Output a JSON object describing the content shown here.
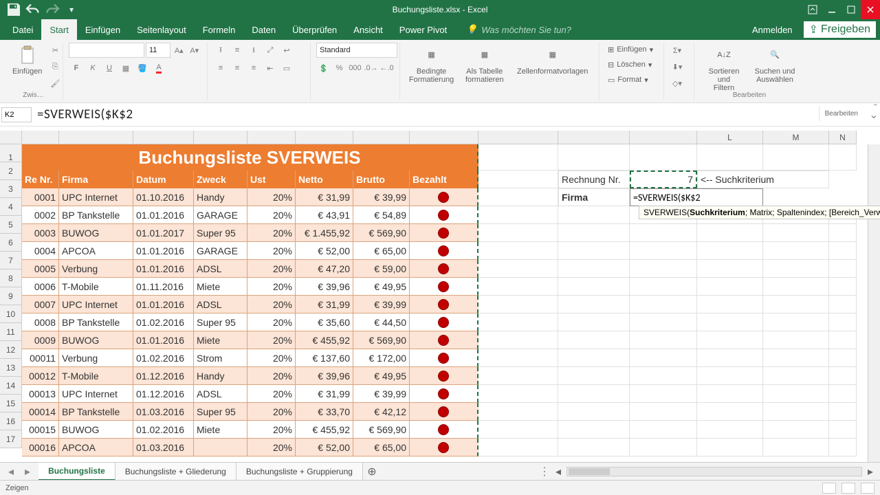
{
  "titlebar": {
    "doc_title": "Buchungsliste.xlsx - Excel"
  },
  "tabs": {
    "file": "Datei",
    "start": "Start",
    "insert": "Einfügen",
    "pagelayout": "Seitenlayout",
    "formulas": "Formeln",
    "data": "Daten",
    "review": "Überprüfen",
    "view": "Ansicht",
    "powerpivot": "Power Pivot",
    "tellme_placeholder": "Was möchten Sie tun?",
    "signin": "Anmelden",
    "share": "Freigeben"
  },
  "ribbon": {
    "paste": "Einfügen",
    "clip": "Zwis…",
    "font_name": "",
    "font_size": "11",
    "number_format": "Standard",
    "cond": "Bedingte\nFormatierung",
    "table": "Als Tabelle\nformatieren",
    "styles": "Zellenformatvorlagen",
    "insert_btn": "Einfügen",
    "delete_btn": "Löschen",
    "format_btn": "Format",
    "sort": "Sortieren und\nFiltern",
    "find": "Suchen und\nAuswählen",
    "edit_group": "Bearbeiten"
  },
  "formula_bar": {
    "name_box": "K2",
    "formula": "=SVERWEIS($K$2"
  },
  "col_letters": [
    "L",
    "M",
    "N"
  ],
  "table": {
    "title": "Buchungsliste SVERWEIS",
    "headers": [
      "Re Nr.",
      "Firma",
      "Datum",
      "Zweck",
      "Ust",
      "Netto",
      "Brutto",
      "Bezahlt"
    ],
    "rows": [
      [
        "0001",
        "UPC Internet",
        "01.10.2016",
        "Handy",
        "20%",
        "€     31,99",
        "€ 39,99"
      ],
      [
        "0002",
        "BP Tankstelle",
        "01.01.2016",
        "GARAGE",
        "20%",
        "€     43,91",
        "€ 54,89"
      ],
      [
        "0003",
        "BUWOG",
        "01.01.2017",
        "Super 95",
        "20%",
        "€ 1.455,92",
        "€ 569,90"
      ],
      [
        "0004",
        "APCOA",
        "01.01.2016",
        "GARAGE",
        "20%",
        "€     52,00",
        "€ 65,00"
      ],
      [
        "0005",
        "Verbung",
        "01.01.2016",
        "ADSL",
        "20%",
        "€     47,20",
        "€ 59,00"
      ],
      [
        "0006",
        "T-Mobile",
        "01.11.2016",
        "Miete",
        "20%",
        "€     39,96",
        "€ 49,95"
      ],
      [
        "0007",
        "UPC Internet",
        "01.01.2016",
        "ADSL",
        "20%",
        "€     31,99",
        "€ 39,99"
      ],
      [
        "0008",
        "BP Tankstelle",
        "01.02.2016",
        "Super 95",
        "20%",
        "€     35,60",
        "€ 44,50"
      ],
      [
        "0009",
        "BUWOG",
        "01.01.2016",
        "Miete",
        "20%",
        "€   455,92",
        "€ 569,90"
      ],
      [
        "00011",
        "Verbung",
        "01.02.2016",
        "Strom",
        "20%",
        "€   137,60",
        "€ 172,00"
      ],
      [
        "00012",
        "T-Mobile",
        "01.12.2016",
        "Handy",
        "20%",
        "€     39,96",
        "€ 49,95"
      ],
      [
        "00013",
        "UPC Internet",
        "01.12.2016",
        "ADSL",
        "20%",
        "€     31,99",
        "€ 39,99"
      ],
      [
        "00014",
        "BP Tankstelle",
        "01.03.2016",
        "Super 95",
        "20%",
        "€     33,70",
        "€ 42,12"
      ],
      [
        "00015",
        "BUWOG",
        "01.02.2016",
        "Miete",
        "20%",
        "€   455,92",
        "€ 569,90"
      ],
      [
        "00016",
        "APCOA",
        "01.03.2016",
        "",
        "20%",
        "€     52,00",
        "€ 65,00"
      ]
    ]
  },
  "side": {
    "label_rechnung": "Rechnung Nr.",
    "value_rechnung": "7",
    "suchkriterium": "<-- Suchkriterium",
    "label_firma": "Firma",
    "editing_formula": "=SVERWEIS($K$2",
    "tooltip_func": "SVERWEIS(",
    "tooltip_arg1": "Suchkriterium",
    "tooltip_rest": "; Matrix; Spaltenindex; [Bereich_Verweis"
  },
  "sheets": {
    "s1": "Buchungsliste",
    "s2": "Buchungsliste + Gliederung",
    "s3": "Buchungsliste + Gruppierung"
  },
  "statusbar": {
    "mode": "Zeigen"
  },
  "col_widths": {
    "A": 54,
    "B": 108,
    "C": 88,
    "D": 78,
    "E": 70,
    "F": 84,
    "G": 82,
    "H": 100,
    "I": 116,
    "J": 104,
    "K": 98,
    "L": 96,
    "M": 96,
    "N": 40
  }
}
